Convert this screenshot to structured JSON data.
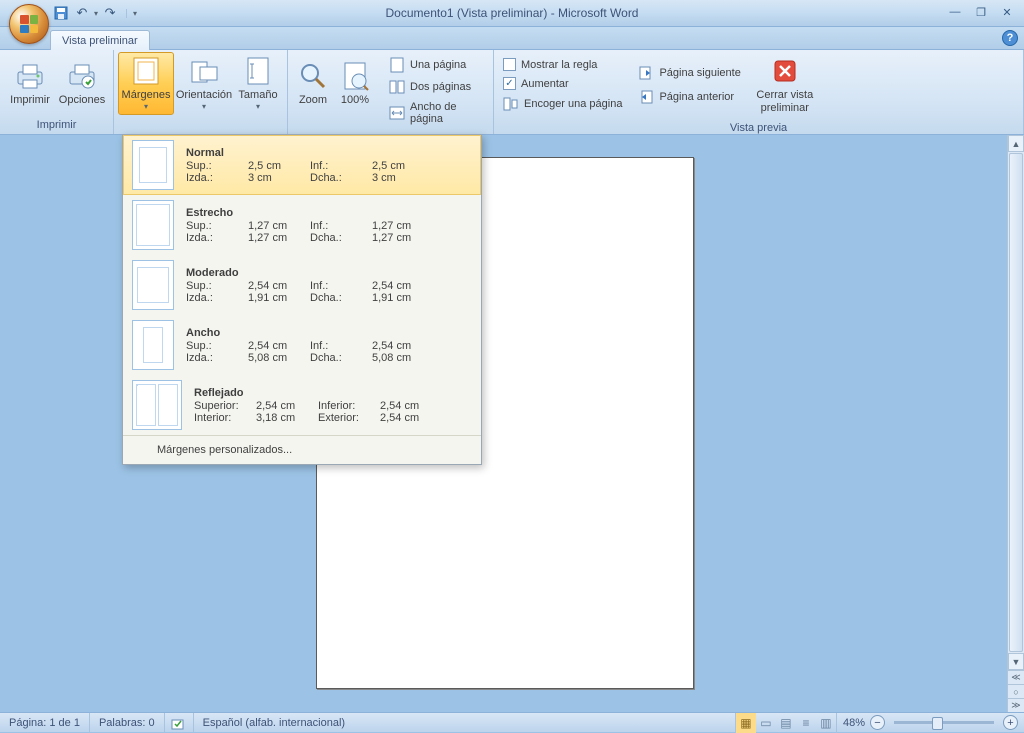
{
  "title": "Documento1 (Vista preliminar) - Microsoft Word",
  "tab": "Vista preliminar",
  "ribbon": {
    "print": {
      "label": "Imprimir",
      "items": {
        "imprimir": "Imprimir",
        "opciones": "Opciones"
      }
    },
    "page_setup": {
      "margenes": "Márgenes",
      "orientacion": "Orientación",
      "tamano": "Tamaño"
    },
    "zoom": {
      "zoom": "Zoom",
      "pct": "100%",
      "una": "Una página",
      "dos": "Dos páginas",
      "ancho": "Ancho de página"
    },
    "preview": {
      "label": "Vista previa",
      "regla": "Mostrar la regla",
      "regla_checked": false,
      "aumentar": "Aumentar",
      "aumentar_checked": true,
      "encoger": "Encoger una página",
      "sig": "Página siguiente",
      "ant": "Página anterior",
      "cerrar": "Cerrar vista preliminar"
    }
  },
  "gallery": {
    "items": [
      {
        "name": "Normal",
        "l1": "Sup.:",
        "v1": "2,5 cm",
        "l2": "Inf.:",
        "v2": "2,5 cm",
        "l3": "Izda.:",
        "v3": "3 cm",
        "l4": "Dcha.:",
        "v4": "3 cm"
      },
      {
        "name": "Estrecho",
        "l1": "Sup.:",
        "v1": "1,27 cm",
        "l2": "Inf.:",
        "v2": "1,27 cm",
        "l3": "Izda.:",
        "v3": "1,27 cm",
        "l4": "Dcha.:",
        "v4": "1,27 cm"
      },
      {
        "name": "Moderado",
        "l1": "Sup.:",
        "v1": "2,54 cm",
        "l2": "Inf.:",
        "v2": "2,54 cm",
        "l3": "Izda.:",
        "v3": "1,91 cm",
        "l4": "Dcha.:",
        "v4": "1,91 cm"
      },
      {
        "name": "Ancho",
        "l1": "Sup.:",
        "v1": "2,54 cm",
        "l2": "Inf.:",
        "v2": "2,54 cm",
        "l3": "Izda.:",
        "v3": "5,08 cm",
        "l4": "Dcha.:",
        "v4": "5,08 cm"
      },
      {
        "name": "Reflejado",
        "l1": "Superior:",
        "v1": "2,54 cm",
        "l2": "Inferior:",
        "v2": "2,54 cm",
        "l3": "Interior:",
        "v3": "3,18 cm",
        "l4": "Exterior:",
        "v4": "2,54 cm"
      }
    ],
    "custom": "Márgenes personalizados..."
  },
  "status": {
    "page": "Página: 1 de 1",
    "words": "Palabras: 0",
    "lang": "Español (alfab. internacional)",
    "zoom": "48%"
  }
}
